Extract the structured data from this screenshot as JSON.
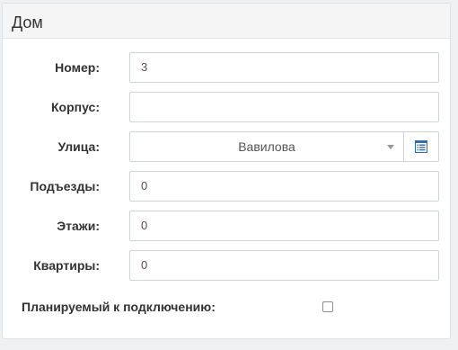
{
  "panel": {
    "title": "Дом"
  },
  "fields": {
    "number": {
      "label": "Номер:",
      "value": "3"
    },
    "building": {
      "label": "Корпус:",
      "value": ""
    },
    "street": {
      "label": "Улица:",
      "value": "Вавилова"
    },
    "entrances": {
      "label": "Подъезды:",
      "value": "0"
    },
    "floors": {
      "label": "Этажи:",
      "value": "0"
    },
    "apartments": {
      "label": "Квартиры:",
      "value": "0"
    }
  },
  "planned": {
    "label": "Планируемый к подключению:",
    "checked": false
  },
  "icons": {
    "street_button": "list-icon",
    "street_dropdown": "caret-down-icon"
  },
  "colors": {
    "icon_blue": "#2f6ea8",
    "border": "#cfd4d8",
    "heading_bg": "#f5f5f5"
  }
}
